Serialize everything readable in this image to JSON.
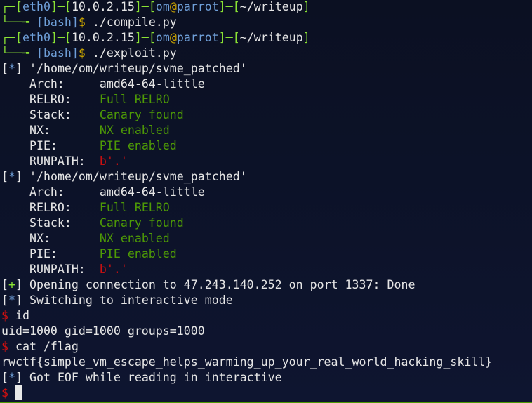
{
  "colors": {
    "prompt_frame": "#8ae234",
    "prompt_text": "#6f9fd8",
    "value_green": "#4e9a06",
    "error_red": "#d01010",
    "at_sign": "#c4a000",
    "background": "#0d1328"
  },
  "lines": [
    [
      {
        "t": "┌─[",
        "c": "g"
      },
      {
        "t": "eth0",
        "c": "b"
      },
      {
        "t": "]─[",
        "c": "g"
      },
      {
        "t": "10.0.2.15",
        "c": "w"
      },
      {
        "t": "]─[",
        "c": "g"
      },
      {
        "t": "om",
        "c": "b"
      },
      {
        "t": "@",
        "c": "y"
      },
      {
        "t": "parrot",
        "c": "b"
      },
      {
        "t": "]─[",
        "c": "g"
      },
      {
        "t": "~/writeup",
        "c": "w"
      },
      {
        "t": "]",
        "c": "g"
      }
    ],
    [
      {
        "t": "└──╼ ",
        "c": "g"
      },
      {
        "t": "[bash]",
        "c": "b"
      },
      {
        "t": "$ ",
        "c": "y"
      },
      {
        "t": "./compile.py",
        "c": "w"
      }
    ],
    [
      {
        "t": "┌─[",
        "c": "g"
      },
      {
        "t": "eth0",
        "c": "b"
      },
      {
        "t": "]─[",
        "c": "g"
      },
      {
        "t": "10.0.2.15",
        "c": "w"
      },
      {
        "t": "]─[",
        "c": "g"
      },
      {
        "t": "om",
        "c": "b"
      },
      {
        "t": "@",
        "c": "y"
      },
      {
        "t": "parrot",
        "c": "b"
      },
      {
        "t": "]─[",
        "c": "g"
      },
      {
        "t": "~/writeup",
        "c": "w"
      },
      {
        "t": "]",
        "c": "g"
      }
    ],
    [
      {
        "t": "└──╼ ",
        "c": "g"
      },
      {
        "t": "[bash]",
        "c": "b"
      },
      {
        "t": "$ ",
        "c": "y"
      },
      {
        "t": "./exploit.py",
        "c": "w"
      }
    ],
    [
      {
        "t": "[",
        "c": "w"
      },
      {
        "t": "*",
        "c": "b"
      },
      {
        "t": "] '/home/om/writeup/svme_patched'",
        "c": "w"
      }
    ],
    [
      {
        "t": "    Arch:     ",
        "c": "w"
      },
      {
        "t": "amd64-64-little",
        "c": "w"
      }
    ],
    [
      {
        "t": "    RELRO:    ",
        "c": "w"
      },
      {
        "t": "Full RELRO",
        "c": "v"
      }
    ],
    [
      {
        "t": "    Stack:    ",
        "c": "w"
      },
      {
        "t": "Canary found",
        "c": "v"
      }
    ],
    [
      {
        "t": "    NX:       ",
        "c": "w"
      },
      {
        "t": "NX enabled",
        "c": "v"
      }
    ],
    [
      {
        "t": "    PIE:      ",
        "c": "w"
      },
      {
        "t": "PIE enabled",
        "c": "v"
      }
    ],
    [
      {
        "t": "    RUNPATH:  ",
        "c": "w"
      },
      {
        "t": "b'.'",
        "c": "r"
      }
    ],
    [
      {
        "t": "[",
        "c": "w"
      },
      {
        "t": "*",
        "c": "b"
      },
      {
        "t": "] '/home/om/writeup/svme_patched'",
        "c": "w"
      }
    ],
    [
      {
        "t": "    Arch:     ",
        "c": "w"
      },
      {
        "t": "amd64-64-little",
        "c": "w"
      }
    ],
    [
      {
        "t": "    RELRO:    ",
        "c": "w"
      },
      {
        "t": "Full RELRO",
        "c": "v"
      }
    ],
    [
      {
        "t": "    Stack:    ",
        "c": "w"
      },
      {
        "t": "Canary found",
        "c": "v"
      }
    ],
    [
      {
        "t": "    NX:       ",
        "c": "w"
      },
      {
        "t": "NX enabled",
        "c": "v"
      }
    ],
    [
      {
        "t": "    PIE:      ",
        "c": "w"
      },
      {
        "t": "PIE enabled",
        "c": "v"
      }
    ],
    [
      {
        "t": "    RUNPATH:  ",
        "c": "w"
      },
      {
        "t": "b'.'",
        "c": "r"
      }
    ],
    [
      {
        "t": "[",
        "c": "w"
      },
      {
        "t": "+",
        "c": "g"
      },
      {
        "t": "] Opening connection to 47.243.140.252 on port 1337: Done",
        "c": "w"
      }
    ],
    [
      {
        "t": "[",
        "c": "w"
      },
      {
        "t": "*",
        "c": "b"
      },
      {
        "t": "] Switching to interactive mode",
        "c": "w"
      }
    ],
    [
      {
        "t": "$ ",
        "c": "r"
      },
      {
        "t": "id",
        "c": "w"
      }
    ],
    [
      {
        "t": "uid=1000 gid=1000 groups=1000",
        "c": "w"
      }
    ],
    [
      {
        "t": "$ ",
        "c": "r"
      },
      {
        "t": "cat /flag",
        "c": "w"
      }
    ],
    [
      {
        "t": "rwctf{simple_vm_escape_helps_warming_up_your_real_world_hacking_skill}",
        "c": "w"
      }
    ],
    [
      {
        "t": "[",
        "c": "w"
      },
      {
        "t": "*",
        "c": "b"
      },
      {
        "t": "] Got EOF while reading in interactive",
        "c": "w"
      }
    ],
    [
      {
        "t": "$ ",
        "c": "r"
      }
    ]
  ]
}
